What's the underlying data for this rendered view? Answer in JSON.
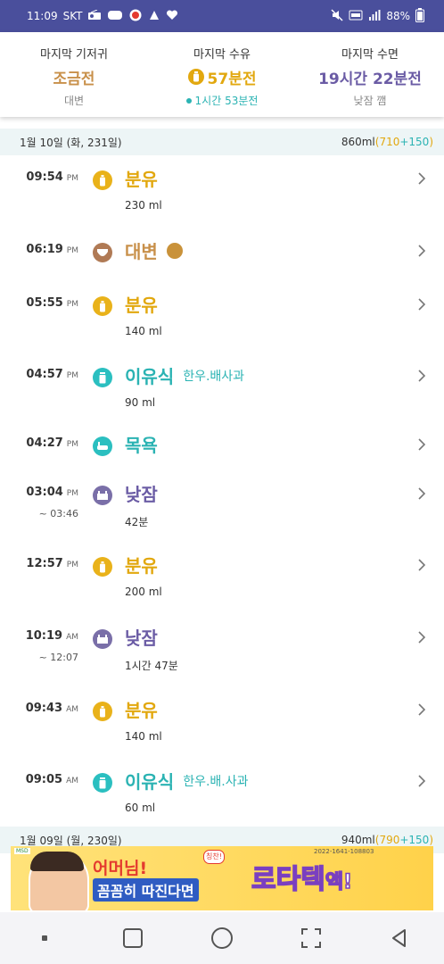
{
  "status_bar": {
    "time": "11:09",
    "carrier": "SKT",
    "battery": "88%"
  },
  "summary": {
    "diaper": {
      "label": "마지막 기저귀",
      "value": "조금전",
      "sub": "대변"
    },
    "feed": {
      "label": "마지막 수유",
      "value": "57분전",
      "sub": "1시간 53분전"
    },
    "sleep": {
      "label": "마지막 수면",
      "value": "19시간 22분전",
      "sub": "낮잠 깸"
    }
  },
  "day1": {
    "date": "1월 10일 (화, 231일)",
    "total": "860ml",
    "total_a": "710",
    "total_b": "150"
  },
  "records": [
    {
      "time": "09:54",
      "ampm": "PM",
      "title": "분유",
      "detail": "230 ml",
      "icon": "bottle-icon"
    },
    {
      "time": "06:19",
      "ampm": "PM",
      "title": "대변",
      "icon": "diaper-icon"
    },
    {
      "time": "05:55",
      "ampm": "PM",
      "title": "분유",
      "detail": "140 ml",
      "icon": "bottle-icon"
    },
    {
      "time": "04:57",
      "ampm": "PM",
      "title": "이유식",
      "sub": "한우.배사과",
      "detail": "90 ml",
      "icon": "baby-food-icon"
    },
    {
      "time": "04:27",
      "ampm": "PM",
      "title": "목욕",
      "icon": "bathtub-icon"
    },
    {
      "time": "03:04",
      "ampm": "PM",
      "end": "~ 03:46",
      "title": "낮잠",
      "detail": "42분",
      "icon": "sleep-icon"
    },
    {
      "time": "12:57",
      "ampm": "PM",
      "title": "분유",
      "detail": "200 ml",
      "icon": "bottle-icon"
    },
    {
      "time": "10:19",
      "ampm": "AM",
      "end": "~ 12:07",
      "title": "낮잠",
      "detail": "1시간 47분",
      "icon": "sleep-icon"
    },
    {
      "time": "09:43",
      "ampm": "AM",
      "title": "분유",
      "detail": "140 ml",
      "icon": "bottle-icon"
    },
    {
      "time": "09:05",
      "ampm": "AM",
      "title": "이유식",
      "sub": "한우.배.사과",
      "detail": "60 ml",
      "icon": "baby-food-icon"
    }
  ],
  "day2": {
    "date": "1월 09일 (월, 230일)",
    "total": "940ml",
    "total_a": "790",
    "total_b": "150"
  },
  "ad": {
    "line1": "어머님!",
    "badge": "칭찬!",
    "line2": "꼼꼼히 따진다면",
    "brand": "로타텍",
    "brand_suffix": "액!",
    "small": "2022-1641-108803",
    "logo": "MSD"
  },
  "colors": {
    "feed": "#e2a80f",
    "diaper": "#c8904a",
    "sleep": "#6b5ca5",
    "solid": "#2bb3b3",
    "header_bg": "#edf5f6",
    "status_bar": "#4a4f9c"
  }
}
